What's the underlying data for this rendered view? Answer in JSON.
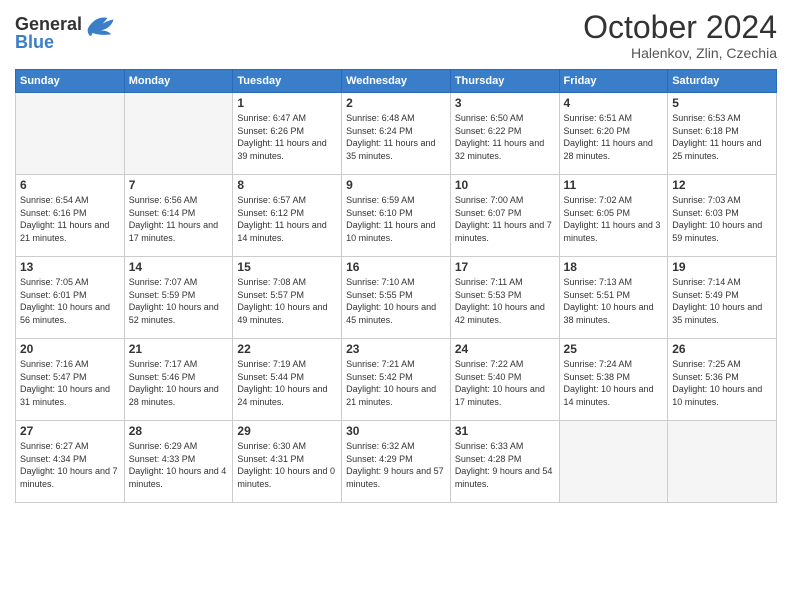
{
  "header": {
    "logo_line1": "General",
    "logo_line2": "Blue",
    "month": "October 2024",
    "location": "Halenkov, Zlin, Czechia"
  },
  "weekdays": [
    "Sunday",
    "Monday",
    "Tuesday",
    "Wednesday",
    "Thursday",
    "Friday",
    "Saturday"
  ],
  "weeks": [
    [
      {
        "day": "",
        "info": ""
      },
      {
        "day": "",
        "info": ""
      },
      {
        "day": "1",
        "info": "Sunrise: 6:47 AM\nSunset: 6:26 PM\nDaylight: 11 hours and 39 minutes."
      },
      {
        "day": "2",
        "info": "Sunrise: 6:48 AM\nSunset: 6:24 PM\nDaylight: 11 hours and 35 minutes."
      },
      {
        "day": "3",
        "info": "Sunrise: 6:50 AM\nSunset: 6:22 PM\nDaylight: 11 hours and 32 minutes."
      },
      {
        "day": "4",
        "info": "Sunrise: 6:51 AM\nSunset: 6:20 PM\nDaylight: 11 hours and 28 minutes."
      },
      {
        "day": "5",
        "info": "Sunrise: 6:53 AM\nSunset: 6:18 PM\nDaylight: 11 hours and 25 minutes."
      }
    ],
    [
      {
        "day": "6",
        "info": "Sunrise: 6:54 AM\nSunset: 6:16 PM\nDaylight: 11 hours and 21 minutes."
      },
      {
        "day": "7",
        "info": "Sunrise: 6:56 AM\nSunset: 6:14 PM\nDaylight: 11 hours and 17 minutes."
      },
      {
        "day": "8",
        "info": "Sunrise: 6:57 AM\nSunset: 6:12 PM\nDaylight: 11 hours and 14 minutes."
      },
      {
        "day": "9",
        "info": "Sunrise: 6:59 AM\nSunset: 6:10 PM\nDaylight: 11 hours and 10 minutes."
      },
      {
        "day": "10",
        "info": "Sunrise: 7:00 AM\nSunset: 6:07 PM\nDaylight: 11 hours and 7 minutes."
      },
      {
        "day": "11",
        "info": "Sunrise: 7:02 AM\nSunset: 6:05 PM\nDaylight: 11 hours and 3 minutes."
      },
      {
        "day": "12",
        "info": "Sunrise: 7:03 AM\nSunset: 6:03 PM\nDaylight: 10 hours and 59 minutes."
      }
    ],
    [
      {
        "day": "13",
        "info": "Sunrise: 7:05 AM\nSunset: 6:01 PM\nDaylight: 10 hours and 56 minutes."
      },
      {
        "day": "14",
        "info": "Sunrise: 7:07 AM\nSunset: 5:59 PM\nDaylight: 10 hours and 52 minutes."
      },
      {
        "day": "15",
        "info": "Sunrise: 7:08 AM\nSunset: 5:57 PM\nDaylight: 10 hours and 49 minutes."
      },
      {
        "day": "16",
        "info": "Sunrise: 7:10 AM\nSunset: 5:55 PM\nDaylight: 10 hours and 45 minutes."
      },
      {
        "day": "17",
        "info": "Sunrise: 7:11 AM\nSunset: 5:53 PM\nDaylight: 10 hours and 42 minutes."
      },
      {
        "day": "18",
        "info": "Sunrise: 7:13 AM\nSunset: 5:51 PM\nDaylight: 10 hours and 38 minutes."
      },
      {
        "day": "19",
        "info": "Sunrise: 7:14 AM\nSunset: 5:49 PM\nDaylight: 10 hours and 35 minutes."
      }
    ],
    [
      {
        "day": "20",
        "info": "Sunrise: 7:16 AM\nSunset: 5:47 PM\nDaylight: 10 hours and 31 minutes."
      },
      {
        "day": "21",
        "info": "Sunrise: 7:17 AM\nSunset: 5:46 PM\nDaylight: 10 hours and 28 minutes."
      },
      {
        "day": "22",
        "info": "Sunrise: 7:19 AM\nSunset: 5:44 PM\nDaylight: 10 hours and 24 minutes."
      },
      {
        "day": "23",
        "info": "Sunrise: 7:21 AM\nSunset: 5:42 PM\nDaylight: 10 hours and 21 minutes."
      },
      {
        "day": "24",
        "info": "Sunrise: 7:22 AM\nSunset: 5:40 PM\nDaylight: 10 hours and 17 minutes."
      },
      {
        "day": "25",
        "info": "Sunrise: 7:24 AM\nSunset: 5:38 PM\nDaylight: 10 hours and 14 minutes."
      },
      {
        "day": "26",
        "info": "Sunrise: 7:25 AM\nSunset: 5:36 PM\nDaylight: 10 hours and 10 minutes."
      }
    ],
    [
      {
        "day": "27",
        "info": "Sunrise: 6:27 AM\nSunset: 4:34 PM\nDaylight: 10 hours and 7 minutes."
      },
      {
        "day": "28",
        "info": "Sunrise: 6:29 AM\nSunset: 4:33 PM\nDaylight: 10 hours and 4 minutes."
      },
      {
        "day": "29",
        "info": "Sunrise: 6:30 AM\nSunset: 4:31 PM\nDaylight: 10 hours and 0 minutes."
      },
      {
        "day": "30",
        "info": "Sunrise: 6:32 AM\nSunset: 4:29 PM\nDaylight: 9 hours and 57 minutes."
      },
      {
        "day": "31",
        "info": "Sunrise: 6:33 AM\nSunset: 4:28 PM\nDaylight: 9 hours and 54 minutes."
      },
      {
        "day": "",
        "info": ""
      },
      {
        "day": "",
        "info": ""
      }
    ]
  ]
}
